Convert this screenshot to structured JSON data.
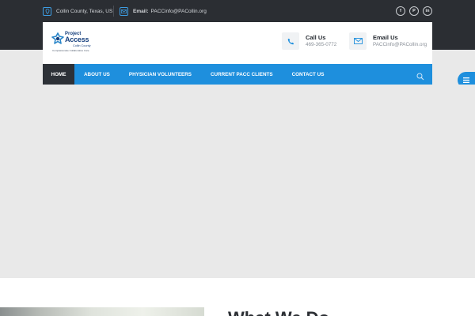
{
  "topbar": {
    "location": "Collin County, Texas, US",
    "email_label": "Email:",
    "email_value": "PACCinfo@PACollin.org",
    "socials": [
      {
        "icon": "facebook-icon",
        "glyph": "f"
      },
      {
        "icon": "pinterest-icon",
        "glyph": "P"
      },
      {
        "icon": "linkedin-icon",
        "glyph": "in"
      }
    ]
  },
  "logo": {
    "line1": "Project",
    "line2": "Access",
    "line3": "Collin County",
    "tagline": "Compassionate Collaborative Care"
  },
  "contacts": {
    "call_label": "Call Us",
    "call_value": "469-365-0772",
    "email_label": "Email Us",
    "email_value": "PACCinfo@PACollin.org"
  },
  "nav": {
    "items": [
      "HOME",
      "ABOUT US",
      "PHYSICIAN VOLUNTEERS",
      "CURRENT PACC CLIENTS",
      "CONTACT US"
    ]
  },
  "section": {
    "heading": "What We Do"
  },
  "colors": {
    "accent": "#1e8fdd",
    "dark": "#2b2e33",
    "hero": "#e9e9e9",
    "brand": "#17407e"
  }
}
